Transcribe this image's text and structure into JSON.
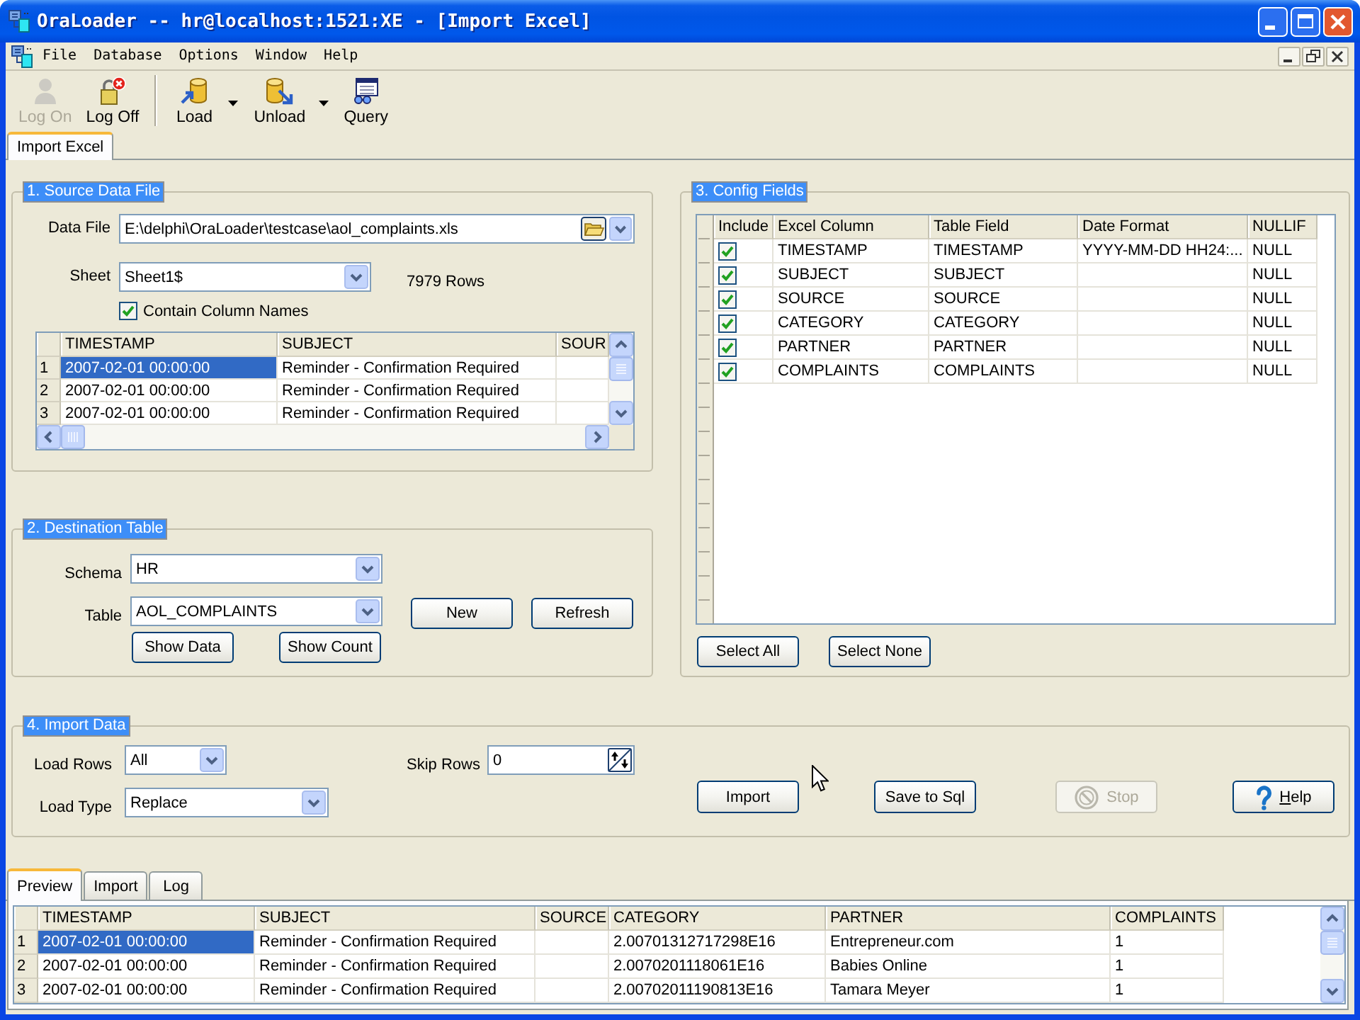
{
  "window": {
    "title": "OraLoader -- hr@localhost:1521:XE - [Import Excel]"
  },
  "menu": {
    "items": [
      "File",
      "Database",
      "Options",
      "Window",
      "Help"
    ]
  },
  "toolbar": {
    "groups": [
      {
        "items": [
          {
            "kind": "logon",
            "label": "Log On",
            "disabled": true,
            "dropdown": false
          },
          {
            "kind": "logoff",
            "label": "Log Off",
            "disabled": false,
            "dropdown": false
          }
        ]
      },
      {
        "items": [
          {
            "kind": "load",
            "label": "Load",
            "disabled": false,
            "dropdown": true
          },
          {
            "kind": "unload",
            "label": "Unload",
            "disabled": false,
            "dropdown": true
          },
          {
            "kind": "query",
            "label": "Query",
            "disabled": false,
            "dropdown": false
          }
        ]
      }
    ]
  },
  "document_tabs": [
    {
      "label": "Import Excel",
      "selected": true
    }
  ],
  "source_data_file": {
    "legend": "1. Source Data File",
    "data_file": {
      "label": "Data File",
      "value": "E:\\delphi\\OraLoader\\testcase\\aol_complaints.xls"
    },
    "sheet": {
      "label": "Sheet",
      "value": "Sheet1$"
    },
    "row_count": "7979 Rows",
    "contain_column_names": {
      "label": "Contain Column Names",
      "checked": true
    },
    "grid": {
      "columns": [
        "TIMESTAMP",
        "SUBJECT",
        "SOUR"
      ],
      "rows": [
        {
          "number": "1",
          "selected": true,
          "cells": [
            "2007-02-01 00:00:00",
            "Reminder - Confirmation Required",
            null
          ]
        },
        {
          "number": "2",
          "selected": false,
          "cells": [
            "2007-02-01 00:00:00",
            "Reminder - Confirmation Required",
            null
          ]
        },
        {
          "number": "3",
          "selected": false,
          "cells": [
            "2007-02-01 00:00:00",
            "Reminder - Confirmation Required",
            null
          ]
        }
      ]
    }
  },
  "config_fields": {
    "legend": "3. Config Fields",
    "columns": [
      "Include",
      "Excel Column",
      "Table Field",
      "Date Format",
      "NULLIF"
    ],
    "rows": [
      {
        "include": true,
        "excel_column": "TIMESTAMP",
        "table_field": "TIMESTAMP",
        "date_format": "YYYY-MM-DD HH24:...",
        "nullif": "NULL"
      },
      {
        "include": true,
        "excel_column": "SUBJECT",
        "table_field": "SUBJECT",
        "nullif": "NULL"
      },
      {
        "include": true,
        "excel_column": "SOURCE",
        "table_field": "SOURCE",
        "nullif": "NULL"
      },
      {
        "include": true,
        "excel_column": "CATEGORY",
        "table_field": "CATEGORY",
        "nullif": "NULL"
      },
      {
        "include": true,
        "excel_column": "PARTNER",
        "table_field": "PARTNER",
        "nullif": "NULL"
      },
      {
        "include": true,
        "excel_column": "COMPLAINTS",
        "table_field": "COMPLAINTS",
        "nullif": "NULL"
      }
    ],
    "buttons": [
      "Select All",
      "Select None"
    ]
  },
  "destination_table": {
    "legend": "2. Destination Table",
    "schema": {
      "label": "Schema",
      "value": "HR"
    },
    "table": {
      "label": "Table",
      "value": "AOL_COMPLAINTS"
    },
    "buttons": [
      "New",
      "Refresh",
      "Show Data",
      "Show Count"
    ]
  },
  "import_data": {
    "legend": "4. Import Data",
    "load_rows": {
      "label": "Load Rows",
      "value": "All"
    },
    "skip_rows": {
      "label": "Skip Rows",
      "value": "0"
    },
    "load_type": {
      "label": "Load Type",
      "value": "Replace"
    },
    "buttons": [
      {
        "kind": "plain",
        "label": "Import",
        "disabled": false
      },
      {
        "kind": "plain",
        "label": "Save to Sql",
        "disabled": false
      },
      {
        "kind": "stop",
        "label": "Stop",
        "disabled": true
      },
      {
        "kind": "help",
        "label": "Help",
        "disabled": false,
        "mnemonic": true
      }
    ]
  },
  "result_tabs": [
    {
      "label": "Preview",
      "selected": true
    },
    {
      "label": "Import",
      "selected": false
    },
    {
      "label": "Log",
      "selected": false
    }
  ],
  "preview_grid": {
    "columns": [
      "TIMESTAMP",
      "SUBJECT",
      "SOURCE",
      "CATEGORY",
      "PARTNER",
      "COMPLAINTS"
    ],
    "rows": [
      {
        "number": "1",
        "selected": true,
        "cells": [
          "2007-02-01 00:00:00",
          "Reminder - Confirmation Required",
          null,
          "2.00701312717298E16",
          "Entrepreneur.com",
          "1"
        ]
      },
      {
        "number": "2",
        "selected": false,
        "cells": [
          "2007-02-01 00:00:00",
          "Reminder - Confirmation Required",
          null,
          "2.0070201118061E16",
          "Babies Online",
          "1"
        ]
      },
      {
        "number": "3",
        "selected": false,
        "cells": [
          "2007-02-01 00:00:00",
          "Reminder - Confirmation Required",
          null,
          "2.00702011190813E16",
          "Tamara Meyer",
          "1"
        ]
      }
    ]
  }
}
